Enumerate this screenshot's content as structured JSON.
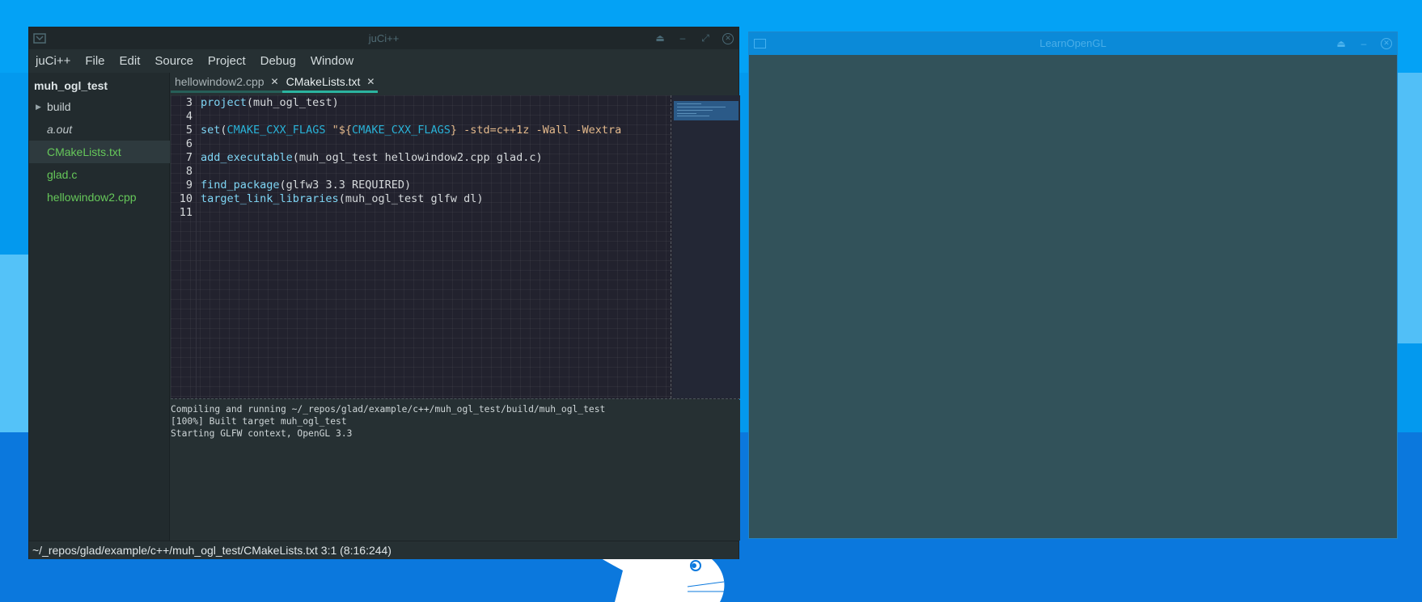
{
  "juci_window": {
    "title": "juCi++",
    "controls": {
      "keep_above": "⏏",
      "minimize": "–",
      "maximize": "⤢",
      "close": "✕"
    },
    "menu": [
      "juCi++",
      "File",
      "Edit",
      "Source",
      "Project",
      "Debug",
      "Window"
    ],
    "sidebar": {
      "project_name": "muh_ogl_test",
      "items": [
        {
          "label": "build",
          "type": "folder"
        },
        {
          "label": "a.out",
          "type": "file"
        },
        {
          "label": "CMakeLists.txt",
          "type": "file"
        },
        {
          "label": "glad.c",
          "type": "file"
        },
        {
          "label": "hellowindow2.cpp",
          "type": "file"
        }
      ]
    },
    "tabs": [
      {
        "label": "hellowindow2.cpp",
        "close": "✕"
      },
      {
        "label": "CMakeLists.txt",
        "close": "✕"
      }
    ],
    "editor": {
      "line_numbers": [
        "3",
        "4",
        "5",
        "6",
        "7",
        "8",
        "9",
        "10",
        "11"
      ],
      "lines": [
        {
          "kw": "project",
          "rest": "(muh_ogl_test)"
        },
        {
          "kw": "",
          "rest": ""
        },
        {
          "kw": "set",
          "p1": "(",
          "v1": "CMAKE_CXX_FLAGS",
          "s1": " \"${",
          "v2": "CMAKE_CXX_FLAGS",
          "s2": "} -std=c++1z -Wall -Wextra"
        },
        {
          "kw": "",
          "rest": ""
        },
        {
          "kw": "add_executable",
          "rest": "(muh_ogl_test hellowindow2.cpp glad.c)"
        },
        {
          "kw": "",
          "rest": ""
        },
        {
          "kw": "find_package",
          "rest": "(glfw3 3.3 REQUIRED)"
        },
        {
          "kw": "target_link_libraries",
          "rest": "(muh_ogl_test glfw dl)"
        },
        {
          "kw": "",
          "rest": ""
        }
      ]
    },
    "terminal": [
      "Compiling and running ~/_repos/glad/example/c++/muh_ogl_test/build/muh_ogl_test",
      "[100%] Built target muh_ogl_test",
      "Starting GLFW context, OpenGL 3.3"
    ],
    "status": "~/_repos/glad/example/c++/muh_ogl_test/CMakeLists.txt 3:1 (8:16:244)"
  },
  "gl_window": {
    "title": "LearnOpenGL",
    "controls": {
      "keep_above": "⏏",
      "minimize": "–",
      "close": "✕"
    }
  },
  "colors": {
    "desktop": "#0399ee",
    "accent_tab": "#2bb4a0",
    "gl_clear": "#32525a",
    "file_green": "#66c85a"
  }
}
